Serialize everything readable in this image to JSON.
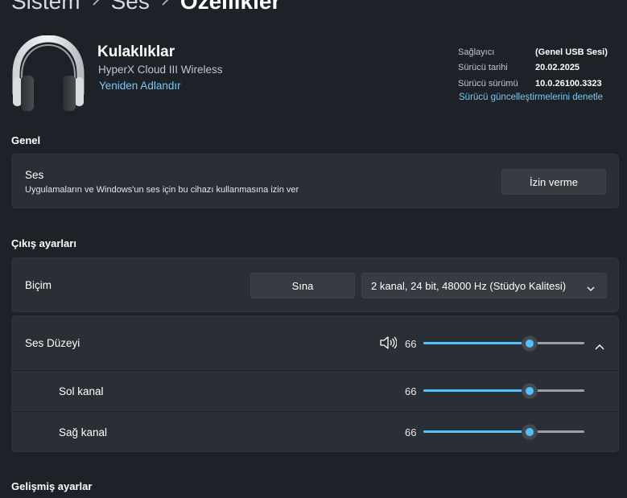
{
  "breadcrumb": {
    "item1": "Sistem",
    "item2": "Ses",
    "current": "Özellikler",
    "separator_icon": "chevron-right-icon"
  },
  "device": {
    "icon": "headphones-icon",
    "name": "Kulaklıklar",
    "model": "HyperX Cloud III Wireless",
    "rename_link": "Yeniden Adlandır"
  },
  "driver_info": {
    "provider_label": "Sağlayıcı",
    "provider_value": "(Genel USB Sesi)",
    "date_label": "Sürücü tarihi",
    "date_value": "20.02.2025",
    "version_label": "Sürücü sürümü",
    "version_value": "10.0.26100.3323",
    "update_link": "Sürücü güncelleştirmelerini denetle"
  },
  "general": {
    "section_title": "Genel",
    "audio_title": "Ses",
    "audio_description": "Uygulamaların ve Windows'un ses için bu cihazı kullanmasına izin ver",
    "deny_button": "İzin verme"
  },
  "output": {
    "section_title": "Çıkış ayarları",
    "format_label": "Biçim",
    "test_button": "Sına",
    "format_value": "2 kanal, 24 bit, 48000 Hz (Stüdyo Kalitesi)",
    "volume_label": "Ses Düzeyi",
    "volume_value": "66",
    "volume_percent": 66,
    "left_label": "Sol kanal",
    "left_value": "66",
    "left_percent": 66,
    "right_label": "Sağ kanal",
    "right_value": "66",
    "right_percent": 66,
    "speaker_icon": "speaker-volume-icon",
    "collapse_icon": "chevron-up-icon"
  },
  "advanced": {
    "section_title": "Gelişmiş ayarlar"
  },
  "colors": {
    "accent": "#4cc2ff",
    "link": "#78c9f2",
    "background": "#1d2229",
    "card": "#2a2f36"
  }
}
